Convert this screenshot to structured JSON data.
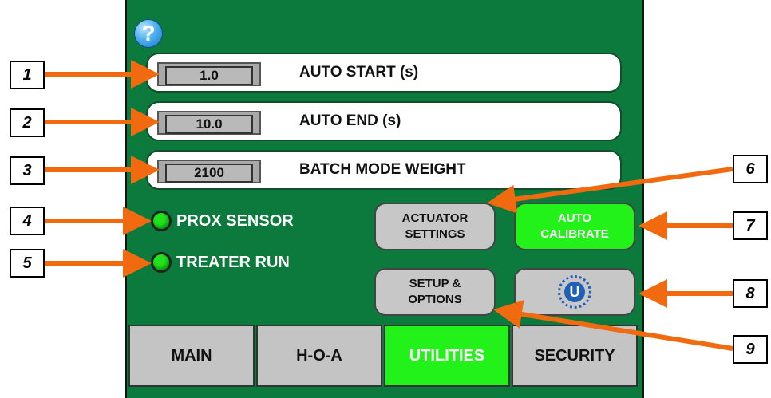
{
  "help_icon": "?",
  "params": [
    {
      "value": "1.0",
      "label": "AUTO START (s)"
    },
    {
      "value": "10.0",
      "label": "AUTO END (s)"
    },
    {
      "value": "2100",
      "label": "BATCH MODE WEIGHT"
    }
  ],
  "indicators": [
    {
      "label": "PROX SENSOR"
    },
    {
      "label": "TREATER RUN"
    }
  ],
  "buttons": {
    "actuator": {
      "line1": "ACTUATOR",
      "line2": "SETTINGS"
    },
    "auto_cal": {
      "line1": "AUTO",
      "line2": "CALIBRATE"
    },
    "setup": {
      "line1": "SETUP &",
      "line2": "OPTIONS"
    },
    "logo": "U"
  },
  "tabs": [
    "MAIN",
    "H-O-A",
    "UTILITIES",
    "SECURITY"
  ],
  "callouts": [
    "1",
    "2",
    "3",
    "4",
    "5",
    "6",
    "7",
    "8",
    "9"
  ],
  "colors": {
    "panel": "#0b7a3c",
    "active": "#22f21a",
    "arrow": "#f26a10"
  }
}
